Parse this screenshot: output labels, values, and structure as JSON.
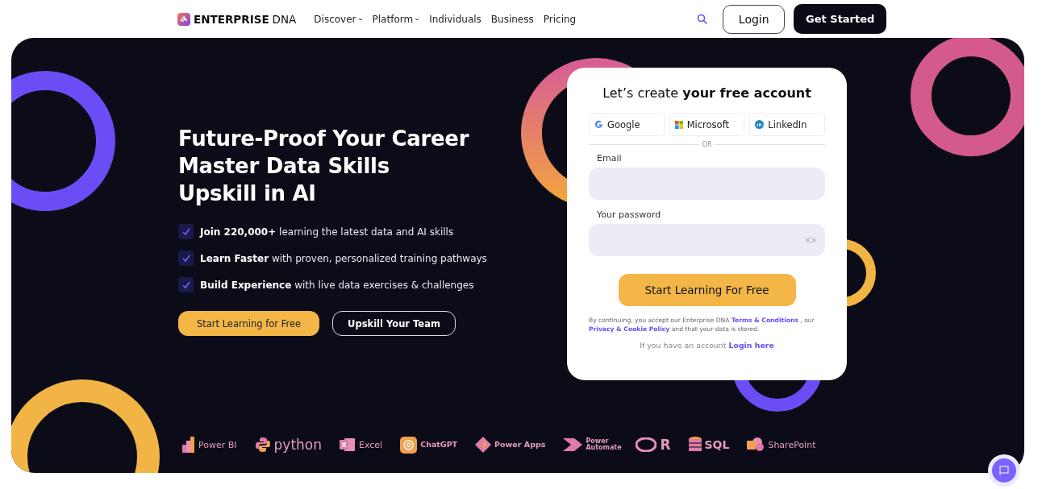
{
  "nav": {
    "brand": {
      "bold": "ENTERPRISE",
      "light": "DNA"
    },
    "items": [
      {
        "label": "Discover",
        "dropdown": true
      },
      {
        "label": "Platform",
        "dropdown": true
      },
      {
        "label": "Individuals",
        "dropdown": false
      },
      {
        "label": "Business",
        "dropdown": false
      },
      {
        "label": "Pricing",
        "dropdown": false
      }
    ],
    "login": "Login",
    "cta": "Get Started"
  },
  "hero": {
    "headline": [
      "Future-Proof Your Career",
      "Master Data Skills",
      "Upskill in AI"
    ],
    "points": [
      {
        "text": "**Join 220,000+** learning the latest data and AI skills",
        "checked": true
      },
      {
        "text": "**Learn Faster** with proven, personalized training pathways",
        "checked": true
      },
      {
        "text": "**Build Experience** with live data exercises & challenges",
        "checked": true
      }
    ],
    "primary": "Start Learning for Free",
    "secondary": "Upskill Your Team"
  },
  "signup": {
    "title": "Let’s create **your free account**",
    "providers": [
      {
        "kind": "google",
        "label": "Google"
      },
      {
        "kind": "microsoft",
        "label": "Microsoft"
      },
      {
        "kind": "linkedin",
        "label": "LinkedIn"
      }
    ],
    "divider": "OR",
    "fields": [
      {
        "kind": "email",
        "label": "Email"
      },
      {
        "kind": "password",
        "label": "Your password"
      }
    ],
    "submit": "Start Learning For Free",
    "legal": [
      "By continuing, you accept our Enterprise DNA ",
      "Terms & Conditions",
      " , our ",
      "Privacy & Cookie Policy",
      " and that your data is stored."
    ],
    "login_prompt": "If you have an account ",
    "login_link": "Login here"
  },
  "tools": [
    {
      "kind": "powerbi",
      "label": "Power BI"
    },
    {
      "kind": "python",
      "label": "python"
    },
    {
      "kind": "excel",
      "label": "Excel"
    },
    {
      "kind": "chatgpt",
      "label": "ChatGPT"
    },
    {
      "kind": "powerapps",
      "label": "Power Apps"
    },
    {
      "kind": "automate",
      "label": "Power Automate"
    },
    {
      "kind": "r",
      "label": "R"
    },
    {
      "kind": "sql",
      "label": "SQL"
    },
    {
      "kind": "sharepoint",
      "label": "SharePoint"
    }
  ]
}
